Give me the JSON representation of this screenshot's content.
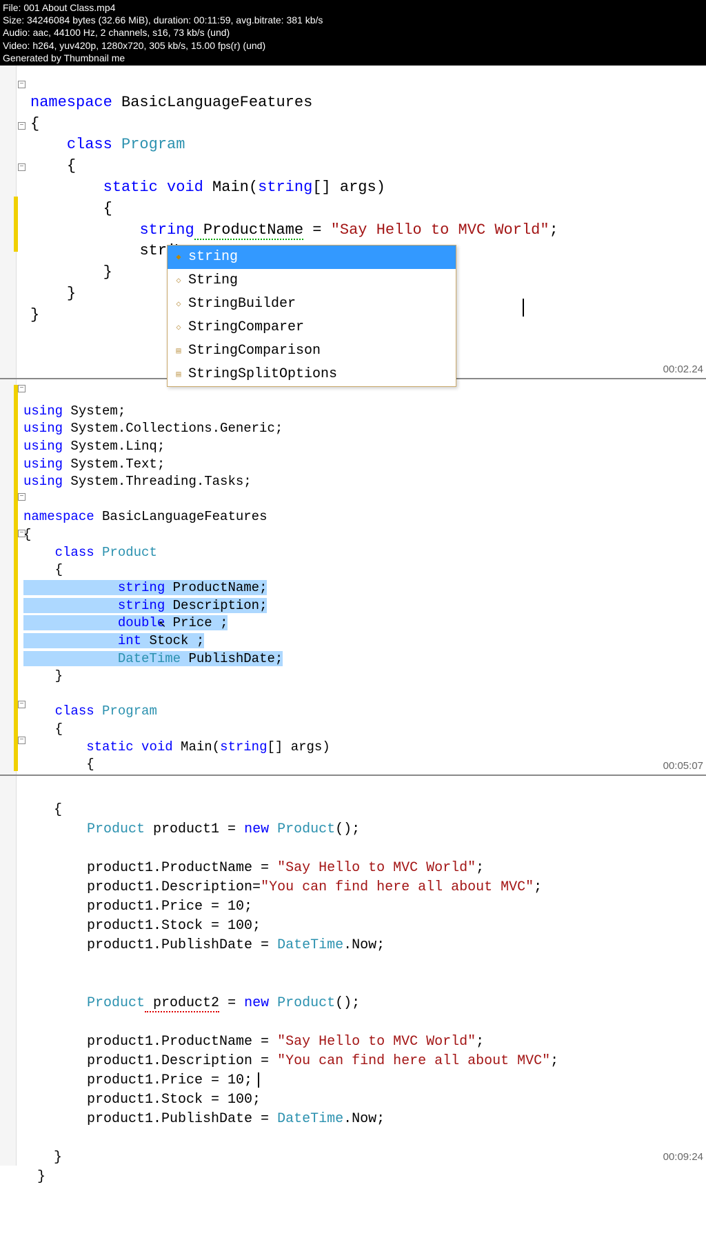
{
  "header": {
    "file": "File: 001 About Class.mp4",
    "size": "Size: 34246084 bytes (32.66 MiB), duration: 00:11:59, avg.bitrate: 381 kb/s",
    "audio": "Audio: aac, 44100 Hz, 2 channels, s16, 73 kb/s (und)",
    "video": "Video: h264, yuv420p, 1280x720, 305 kb/s, 15.00 fps(r) (und)",
    "gen": "Generated by Thumbnail me"
  },
  "intellisense": {
    "items": [
      {
        "label": "string",
        "selected": true,
        "icon": "struct"
      },
      {
        "label": "String",
        "selected": false,
        "icon": "class"
      },
      {
        "label": "StringBuilder",
        "selected": false,
        "icon": "class"
      },
      {
        "label": "StringComparer",
        "selected": false,
        "icon": "class"
      },
      {
        "label": "StringComparison",
        "selected": false,
        "icon": "enum"
      },
      {
        "label": "StringSplitOptions",
        "selected": false,
        "icon": "enum"
      }
    ]
  },
  "p1": {
    "kw_namespace": "namespace",
    "ns_name": " BasicLanguageFeatures",
    "kw_class": "class",
    "class_name": " Program",
    "kw_static": "static",
    "kw_void": " void",
    "main": " Main(",
    "kw_string": "string",
    "args": "[] args)",
    "kw_string2": "string",
    "var1": " ProductName",
    "eq": " = ",
    "str1": "\"Say Hello to MVC World\"",
    "semi": ";",
    "typed": "stri",
    "ob": "{",
    "cb": "}",
    "ts": "00:02.24"
  },
  "p2": {
    "u1a": "using",
    "u1b": " System;",
    "u2a": "using",
    "u2b": " System.Collections.Generic;",
    "u3a": "using",
    "u3b": " System.Linq;",
    "u4a": "using",
    "u4b": " System.Text;",
    "u5a": "using",
    "u5b": " System.Threading.Tasks;",
    "kw_ns": "namespace",
    "ns": " BasicLanguageFeatures",
    "kw_class1": "class",
    "cls1": " Product",
    "f1a": "string",
    "f1b": " ProductName;",
    "f2a": "string",
    "f2b": " Description;",
    "f3a": "double",
    "f3b": " Price ;",
    "f4a": "int",
    "f4b": " Stock ;",
    "f5a": "DateTime",
    "f5b": " PublishDate;",
    "kw_class2": "class",
    "cls2": " Program",
    "kw_static": "static",
    "kw_void": " void",
    "main": " Main(",
    "kw_string": "string",
    "args": "[] args)",
    "ob": "{",
    "cb": "}",
    "ts": "00:05:07"
  },
  "p3": {
    "ob": "{",
    "cb": "}",
    "type": "Product",
    "v1": " product1 = ",
    "kw_new": "new",
    "ctor": " Product",
    "paren": "();",
    "l1a": "product1.ProductName = ",
    "l1b": "\"Say Hello to MVC World\"",
    "semi": ";",
    "l2a": "product1.Description=",
    "l2b": "\"You can find here all about MVC\"",
    "l3": "product1.Price = 10;",
    "l4": "product1.Stock = 100;",
    "l5a": "product1.PublishDate = ",
    "l5b": "DateTime",
    "l5c": ".Now;",
    "v2": " product2",
    "v2eq": " = ",
    "b1a": "product1.ProductName = ",
    "b1b": "\"Say Hello to MVC World\"",
    "b2a": "product1.Description = ",
    "b2b": "\"You can find here all about MVC\"",
    "b3": "product1.Price = 10;",
    "b4": "product1.Stock = 100;",
    "b5a": "product1.PublishDate = ",
    "ts": "00:09:24"
  }
}
